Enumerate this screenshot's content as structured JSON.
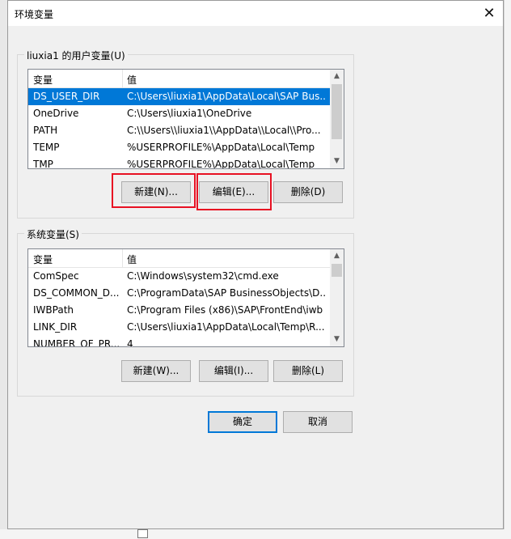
{
  "dialog": {
    "title": "环境变量",
    "close_glyph": "✕"
  },
  "user_vars": {
    "legend": "liuxia1 的用户变量(U)",
    "col_name": "变量",
    "col_value": "值",
    "rows": [
      {
        "name": "DS_USER_DIR",
        "value": "C:\\Users\\liuxia1\\AppData\\Local\\SAP Bus...",
        "selected": true
      },
      {
        "name": "OneDrive",
        "value": "C:\\Users\\liuxia1\\OneDrive"
      },
      {
        "name": "PATH",
        "value": "C:\\\\Users\\\\liuxia1\\\\AppData\\\\Local\\\\Pro..."
      },
      {
        "name": "TEMP",
        "value": "%USERPROFILE%\\AppData\\Local\\Temp"
      },
      {
        "name": "TMP",
        "value": "%USERPROFILE%\\AppData\\Local\\Temp"
      }
    ],
    "buttons": {
      "new": "新建(N)...",
      "edit": "编辑(E)...",
      "delete": "删除(D)"
    }
  },
  "system_vars": {
    "legend": "系统变量(S)",
    "col_name": "变量",
    "col_value": "值",
    "rows": [
      {
        "name": "ComSpec",
        "value": "C:\\Windows\\system32\\cmd.exe"
      },
      {
        "name": "DS_COMMON_D...",
        "value": "C:\\ProgramData\\SAP BusinessObjects\\D..."
      },
      {
        "name": "IWBPath",
        "value": "C:\\Program Files (x86)\\SAP\\FrontEnd\\iwb"
      },
      {
        "name": "LINK_DIR",
        "value": "C:\\Users\\liuxia1\\AppData\\Local\\Temp\\R..."
      },
      {
        "name": "NUMBER_OF_PR...",
        "value": "4"
      }
    ],
    "buttons": {
      "new": "新建(W)...",
      "edit": "编辑(I)...",
      "delete": "删除(L)"
    }
  },
  "footer": {
    "ok": "确定",
    "cancel": "取消"
  },
  "icons": {
    "scroll_up": "▲",
    "scroll_down": "▼"
  },
  "colors": {
    "selection": "#0078d7",
    "highlight": "#e81123",
    "default_button_border": "#0078d7"
  }
}
